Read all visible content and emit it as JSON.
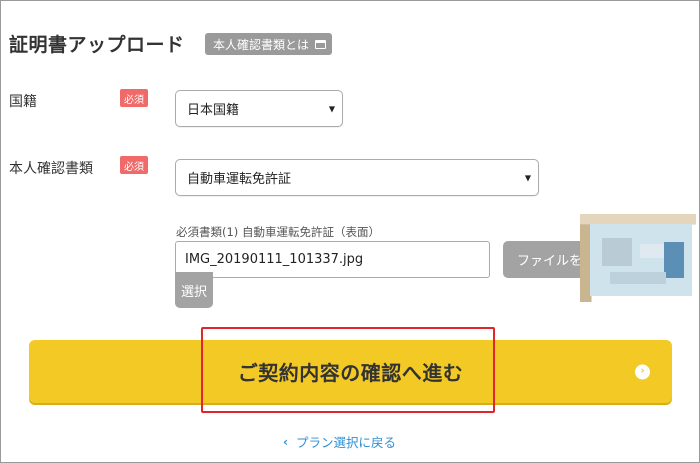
{
  "page_title": "証明書アップロード",
  "info_badge": {
    "label": "本人確認書類とは",
    "icon": "window-icon"
  },
  "nationality": {
    "label": "国籍",
    "required_badge": "必須",
    "selected": "日本国籍"
  },
  "id_document": {
    "label": "本人確認書類",
    "required_badge": "必須",
    "selected": "自動車運転免許証"
  },
  "upload": {
    "caption": "必須書類(1) 自動車運転免許証（表面）",
    "file_name": "IMG_20190111_101337.jpg",
    "button_label": "ファイルを",
    "button_label_wrap": "選択"
  },
  "primary_action": {
    "label": "ご契約内容の確認へ進む",
    "accent": "#f2c925",
    "highlight": "#e0252b"
  },
  "back_link": {
    "label": "プラン選択に戻る",
    "color": "#2f8ed2"
  }
}
